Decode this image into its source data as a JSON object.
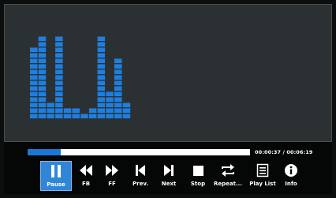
{
  "player": {
    "progress_fraction": 0.148,
    "time_text": "00:00:37 / 00:06:19",
    "equalizer_levels": [
      13,
      15,
      3,
      15,
      2,
      2,
      1,
      2,
      15,
      5,
      11,
      3
    ]
  },
  "controls": [
    {
      "key": "pause",
      "label": "Pause",
      "icon": "pause-icon",
      "active": true
    },
    {
      "key": "fb",
      "label": "FB",
      "icon": "fast-backward-icon",
      "active": false
    },
    {
      "key": "ff",
      "label": "FF",
      "icon": "fast-forward-icon",
      "active": false
    },
    {
      "key": "prev",
      "label": "Prev.",
      "icon": "previous-icon",
      "active": false
    },
    {
      "key": "next",
      "label": "Next",
      "icon": "next-icon",
      "active": false
    },
    {
      "key": "stop",
      "label": "Stop",
      "icon": "stop-icon",
      "active": false
    },
    {
      "key": "repeat",
      "label": "Repeat...",
      "icon": "repeat-icon",
      "active": false
    },
    {
      "key": "playlist",
      "label": "Play List",
      "icon": "playlist-icon",
      "active": false
    },
    {
      "key": "info",
      "label": "Info",
      "icon": "info-icon",
      "active": false
    }
  ],
  "colors": {
    "accent": "#2f86d9",
    "equalizer": "#1f7fe0",
    "progress": "#1b78d6",
    "screen_bg": "#2b3132"
  }
}
